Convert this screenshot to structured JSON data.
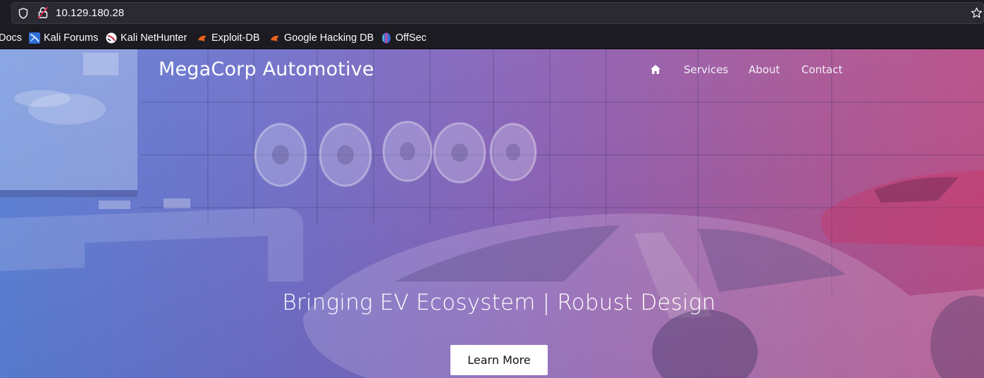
{
  "browser": {
    "url": "10.129.180.28",
    "bookmarks": [
      {
        "label": "Docs",
        "icon": "kali-docs-icon"
      },
      {
        "label": "Kali Forums",
        "icon": "kali-forums-icon"
      },
      {
        "label": "Kali NetHunter",
        "icon": "kali-nethunter-icon"
      },
      {
        "label": "Exploit-DB",
        "icon": "exploit-db-icon"
      },
      {
        "label": "Google Hacking DB",
        "icon": "google-hacking-db-icon"
      },
      {
        "label": "OffSec",
        "icon": "offsec-icon"
      }
    ]
  },
  "site": {
    "brand": "MegaCorp Automotive",
    "nav": {
      "home_icon": "home-icon",
      "services": "Services",
      "about": "About",
      "contact": "Contact"
    },
    "hero": {
      "tagline": "Bringing EV Ecosystem | Robust Design",
      "cta": "Learn More"
    }
  },
  "colors": {
    "gradient_left": "#5a7fd6",
    "gradient_right": "#b84c86",
    "browser_chrome": "#1c1b22"
  }
}
